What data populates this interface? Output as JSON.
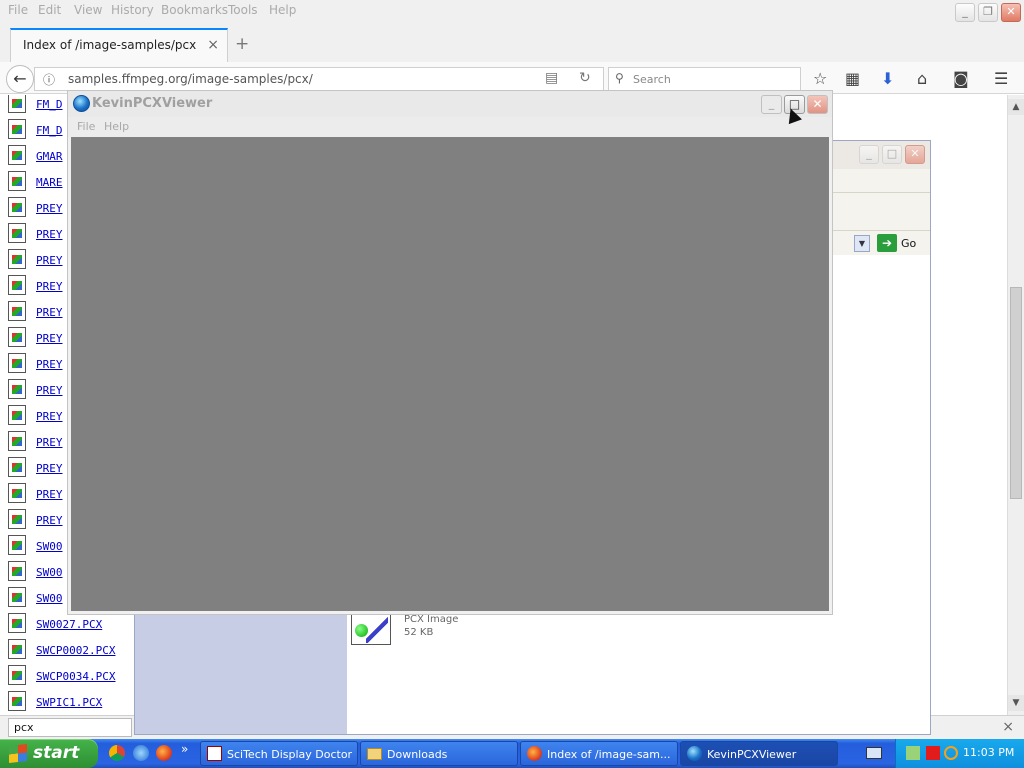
{
  "browser": {
    "menu": [
      "File",
      "Edit",
      "View",
      "History",
      "Bookmarks",
      "Tools",
      "Help"
    ],
    "tab_title": "Index of /image-samples/pcx",
    "tab_close": "×",
    "new_tab": "+",
    "url": "samples.ffmpeg.org/image-samples/pcx/",
    "search_placeholder": "Search"
  },
  "page": {
    "files": [
      "FM_D",
      "FM_D",
      "GMAR",
      "MARE",
      "PREY",
      "PREY",
      "PREY",
      "PREY",
      "PREY",
      "PREY",
      "PREY",
      "PREY",
      "PREY",
      "PREY",
      "PREY",
      "PREY",
      "PREY",
      "SW00",
      "SW00",
      "SW00",
      "SW0027.PCX",
      "SWCP0002.PCX",
      "SWCP0034.PCX",
      "SWPIC1.PCX"
    ]
  },
  "findbar": {
    "value": "pcx",
    "close": "×"
  },
  "explorer": {
    "go_label": "Go",
    "file_type": "PCX Image",
    "file_size": "52 KB"
  },
  "viewer": {
    "title": "KevinPCXViewer",
    "menu": [
      "File",
      "Help"
    ],
    "canvas_color": "#808080"
  },
  "taskbar": {
    "start": "start",
    "tasks": [
      {
        "label": "SciTech Display Doctor",
        "icon": "scitech-icon"
      },
      {
        "label": "Downloads",
        "icon": "folder-icon"
      },
      {
        "label": "Index of /image-sam...",
        "icon": "firefox-icon"
      },
      {
        "label": "KevinPCXViewer",
        "icon": "globe-icon"
      }
    ],
    "clock": "11:03 PM"
  }
}
